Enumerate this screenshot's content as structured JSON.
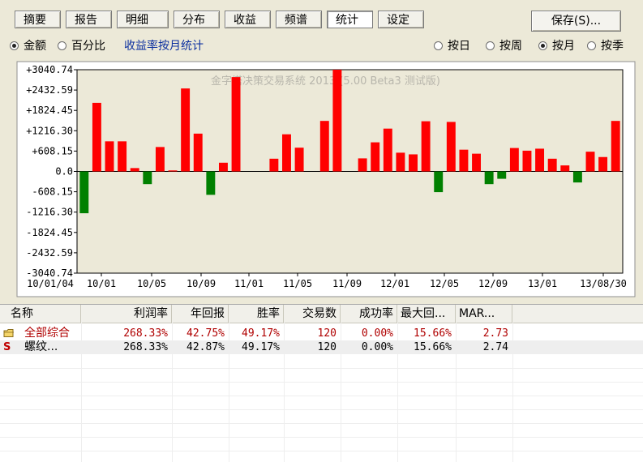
{
  "toolbar": {
    "tabs": [
      "摘要",
      "报告",
      "明细",
      "分布",
      "收益",
      "频谱",
      "统计",
      "设定"
    ],
    "active_tab": "统计",
    "save_label": "保存(S)..."
  },
  "options": {
    "amount_label": "金额",
    "amount_selected": true,
    "percent_label": "百分比",
    "link_label": "收益率按月统计",
    "day_label": "按日",
    "week_label": "按周",
    "month_label": "按月",
    "quarter_label": "按季",
    "selected_period": "按月"
  },
  "chart_data": {
    "type": "bar",
    "watermark": "金字塔决策交易系统 2013 (5.00 Beta3 测试版)",
    "ylim": [
      -3040.74,
      3040.74
    ],
    "yticks": [
      "+3040.74",
      "+2432.59",
      "+1824.45",
      "+1216.30",
      "+608.15",
      "0.0",
      "-608.15",
      "-1216.30",
      "-1824.45",
      "-2432.59",
      "-3040.74"
    ],
    "xticks": [
      "10/01/04",
      "10/01",
      "10/05",
      "10/09",
      "11/01",
      "11/05",
      "11/09",
      "12/01",
      "12/05",
      "12/09",
      "13/01",
      "13/08/30"
    ],
    "values": [
      -1250,
      2050,
      900,
      900,
      100,
      -380,
      730,
      30,
      2480,
      1130,
      -700,
      260,
      2820,
      0,
      0,
      380,
      1110,
      710,
      0,
      1510,
      3040.74,
      0,
      390,
      870,
      1280,
      560,
      510,
      1500,
      -620,
      1480,
      650,
      530,
      -380,
      -220,
      700,
      620,
      680,
      380,
      180,
      -330,
      590,
      430,
      1510
    ],
    "colors": {
      "positive": "#ff0000",
      "negative": "#008000",
      "background": "#ece9d8"
    }
  },
  "table": {
    "columns": [
      "名称",
      "利润率",
      "年回报",
      "胜率",
      "交易数",
      "成功率",
      "最大回...",
      "MAR..."
    ],
    "rows": [
      {
        "icon": "folder-icon",
        "name": "全部综合",
        "profit": "268.33%",
        "annual": "42.75%",
        "win": "49.17%",
        "trades": "120",
        "success": "0.00%",
        "drawdown": "15.66%",
        "mar": "2.73"
      },
      {
        "icon": "S",
        "name": "螺纹...",
        "profit": "268.33%",
        "annual": "42.87%",
        "win": "49.17%",
        "trades": "120",
        "success": "0.00%",
        "drawdown": "15.66%",
        "mar": "2.74"
      }
    ]
  }
}
